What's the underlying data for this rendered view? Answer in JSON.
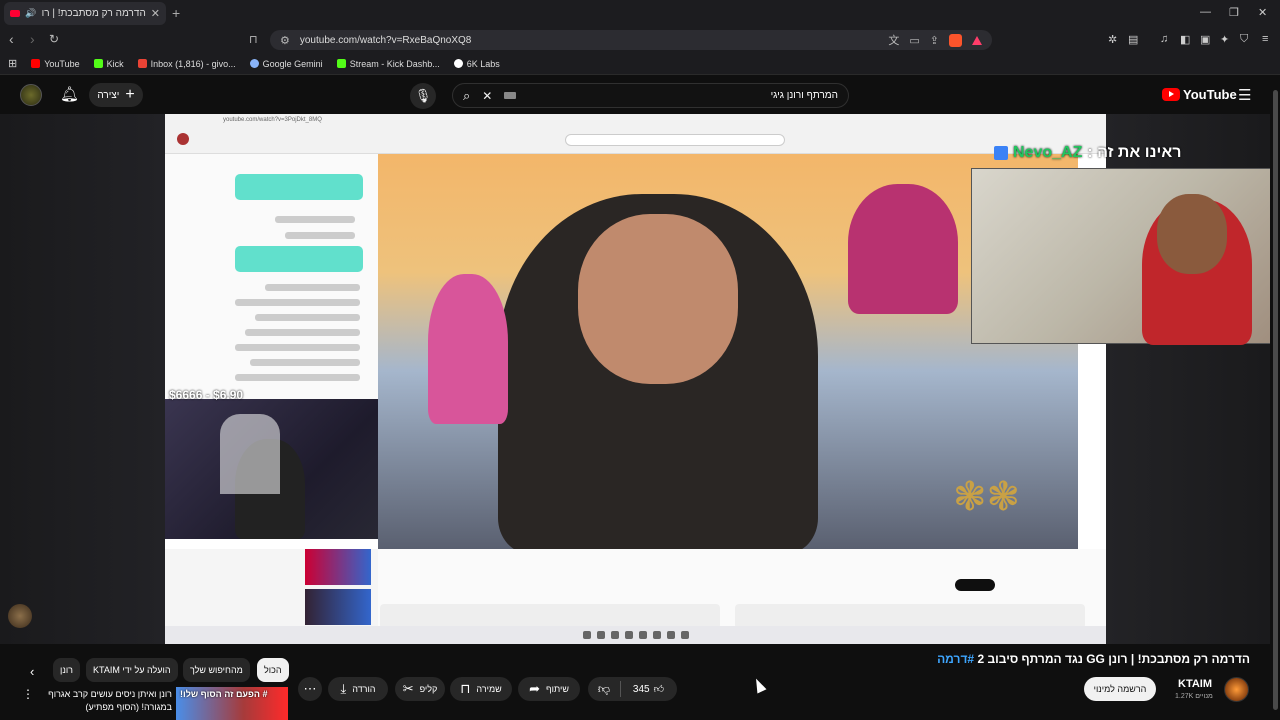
{
  "browser": {
    "tab_title": "הדרמה רק מסתבכת! | רונן GG",
    "url": "youtube.com/watch?v=RxeBaQnoXQ8",
    "bookmarks": [
      {
        "label": "YouTube",
        "color": "#ff0000"
      },
      {
        "label": "Kick",
        "color": "#53fc18"
      },
      {
        "label": "Inbox (1,816) - givo...",
        "color": "#ea4335"
      },
      {
        "label": "Google Gemini",
        "color": "#8ab4f8"
      },
      {
        "label": "Stream - Kick Dashb...",
        "color": "#53fc18"
      },
      {
        "label": "6K Labs",
        "color": "#ffffff"
      }
    ]
  },
  "youtube": {
    "search_query": "המרתף ורונן גיגי",
    "create_label": "יצירה",
    "logo_text": "YouTube"
  },
  "player": {
    "donation_text": "$6666 - $6.90",
    "webcam_caption_prefix": "ראינו את זה :",
    "webcam_caption_name": "Nevo_AZ",
    "inner_url": "youtube.com/watch?v=3PojDkt_8MQ"
  },
  "video": {
    "title_main": "הדרמה רק מסתבכת! | רונן GG נגד המרתף סיבוב 2",
    "title_tag": "#דרמה",
    "channel_name": "KTAIM",
    "subscribers": "1.27K מנויים",
    "subscribe_label": "הרשמה למינוי",
    "like_count": "345",
    "share_label": "שיתוף",
    "save_label": "שמירה",
    "clip_label": "קליפ",
    "download_label": "הורדה"
  },
  "chips": [
    {
      "label": "הכול",
      "active": true
    },
    {
      "label": "מהחיפוש שלך",
      "active": false
    },
    {
      "label": "הועלה על ידי KTAIM",
      "active": false
    },
    {
      "label": "רונן",
      "active": false
    }
  ],
  "recommended": {
    "thumb_text": "# הפעם זה הסוף שלו!",
    "title": "רונן ואיתן ניסים עושים קרב אגרוף במגורה! (הסוף מפתיע)"
  }
}
